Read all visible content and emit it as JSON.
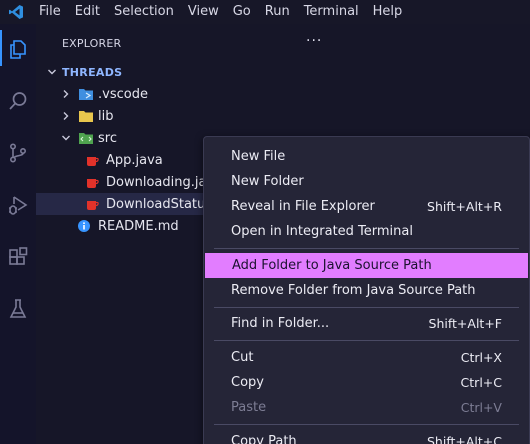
{
  "menubar": {
    "items": [
      "File",
      "Edit",
      "Selection",
      "View",
      "Go",
      "Run",
      "Terminal",
      "Help"
    ]
  },
  "activity_bar": {
    "icons": [
      "files-icon",
      "search-icon",
      "source-control-icon",
      "run-debug-icon",
      "extensions-icon",
      "testing-icon"
    ]
  },
  "explorer": {
    "title": "EXPLORER",
    "more_actions": "···",
    "section": "THREADS",
    "tree": [
      {
        "label": ".vscode",
        "icon": "vscode-folder-icon",
        "expanded": false
      },
      {
        "label": "lib",
        "icon": "folder-icon",
        "expanded": false
      },
      {
        "label": "src",
        "icon": "src-folder-icon",
        "expanded": true
      },
      {
        "label": "App.java",
        "icon": "java-file-icon"
      },
      {
        "label": "Downloading.java",
        "icon": "java-file-icon"
      },
      {
        "label": "DownloadStatus.java",
        "icon": "java-file-icon",
        "selected": true
      },
      {
        "label": "README.md",
        "icon": "info-icon"
      }
    ]
  },
  "context_menu": {
    "items": [
      {
        "label": "New File",
        "shortcut": ""
      },
      {
        "label": "New Folder",
        "shortcut": ""
      },
      {
        "label": "Reveal in File Explorer",
        "shortcut": "Shift+Alt+R"
      },
      {
        "label": "Open in Integrated Terminal",
        "shortcut": ""
      },
      {
        "label": "Add Folder to Java Source Path",
        "shortcut": "",
        "highlighted": true
      },
      {
        "label": "Remove Folder from Java Source Path",
        "shortcut": ""
      },
      {
        "label": "Find in Folder...",
        "shortcut": "Shift+Alt+F"
      },
      {
        "label": "Cut",
        "shortcut": "Ctrl+X"
      },
      {
        "label": "Copy",
        "shortcut": "Ctrl+C"
      },
      {
        "label": "Paste",
        "shortcut": "Ctrl+V",
        "disabled": true
      },
      {
        "label": "Copy Path",
        "shortcut": "Shift+Alt+C"
      }
    ]
  },
  "colors": {
    "highlight": "#e27dff",
    "section": "#8fb6ff",
    "java_icon": "#e2322a",
    "folder_icon": "#e8c64d",
    "vscode_folder_icon": "#3f8fe0",
    "src_folder_icon": "#4fa34f",
    "info_icon": "#3794ff"
  }
}
